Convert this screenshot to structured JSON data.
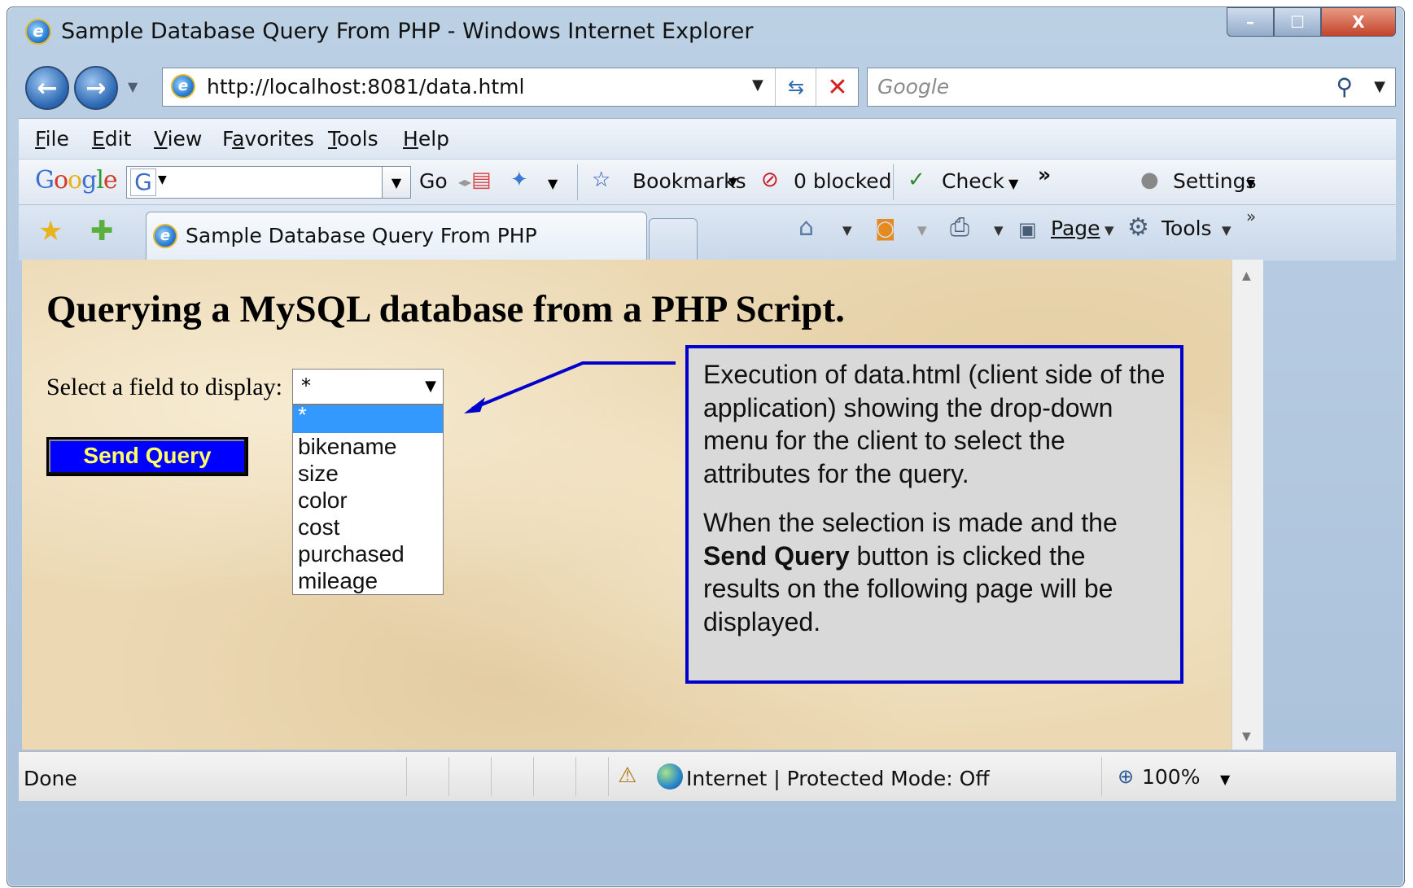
{
  "window": {
    "title": "Sample Database Query From PHP - Windows Internet Explorer",
    "controls": {
      "minimize": "–",
      "maximize": "☐",
      "close": "X"
    }
  },
  "navbar": {
    "back_icon": "back-arrow-icon",
    "forward_icon": "forward-arrow-icon",
    "address": "http://localhost:8081/data.html",
    "search_placeholder": "Google"
  },
  "menu": {
    "items": [
      {
        "label": "File",
        "accel": "F",
        "rest": "ile"
      },
      {
        "label": "Edit",
        "accel": "E",
        "rest": "dit"
      },
      {
        "label": "View",
        "accel": "V",
        "rest": "iew"
      },
      {
        "label": "Favorites",
        "accel": "a",
        "pre": "F",
        "rest": "vorites"
      },
      {
        "label": "Tools",
        "accel": "T",
        "rest": "ools"
      },
      {
        "label": "Help",
        "accel": "H",
        "rest": "elp"
      }
    ]
  },
  "google_toolbar": {
    "logo": "Google",
    "go": "Go",
    "bookmarks": "Bookmarks",
    "blocked": "0 blocked",
    "check": "Check",
    "more": "»",
    "settings": "Settings"
  },
  "tabs": {
    "active_tab": "Sample Database Query From PHP",
    "commands": {
      "page": "Page",
      "tools": "Tools",
      "more": "»"
    }
  },
  "page": {
    "heading": "Querying a MySQL database from a PHP Script.",
    "field_label": "Select a field to display:",
    "selected_value": "*",
    "options": [
      "*",
      "bikename",
      "size",
      "color",
      "cost",
      "purchased",
      "mileage"
    ],
    "button": "Send Query",
    "background_color": "#ecd9b4"
  },
  "callout": {
    "para1": "Execution of data.html (client side of the application) showing the drop-down menu for the client to select the attributes for the query.",
    "para2_pre": "When the selection is made and the ",
    "para2_bold": "Send Query",
    "para2_post": " button is clicked the results on the following page will be displayed.",
    "border_color": "#0000cc"
  },
  "statusbar": {
    "status": "Done",
    "zone": "Internet | Protected Mode: Off",
    "zoom": "100%"
  }
}
